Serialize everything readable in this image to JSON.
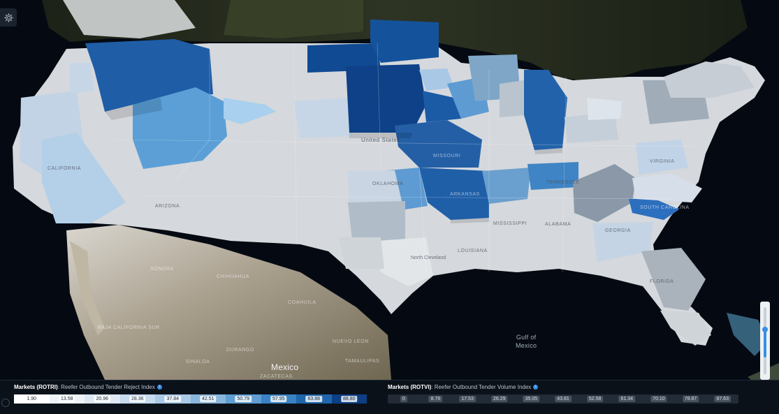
{
  "map": {
    "labels": [
      {
        "id": "label-united-states",
        "text": "United States",
        "style": "dark"
      },
      {
        "id": "label-california",
        "text": "CALIFORNIA",
        "style": "dark"
      },
      {
        "id": "label-arizona",
        "text": "ARIZONA",
        "style": "dark"
      },
      {
        "id": "label-missouri",
        "text": "MISSOURI",
        "style": "dark"
      },
      {
        "id": "label-oklahoma",
        "text": "OKLAHOMA",
        "style": "dark"
      },
      {
        "id": "label-arkansas",
        "text": "ARKANSAS",
        "style": "dark"
      },
      {
        "id": "label-tennessee",
        "text": "TENNESSEE",
        "style": "dark"
      },
      {
        "id": "label-mississippi",
        "text": "MISSISSIPPI",
        "style": "dark"
      },
      {
        "id": "label-alabama",
        "text": "ALABAMA",
        "style": "dark"
      },
      {
        "id": "label-georgia",
        "text": "GEORGIA",
        "style": "dark"
      },
      {
        "id": "label-louisiana",
        "text": "LOUISIANA",
        "style": "dark"
      },
      {
        "id": "label-south-carolina",
        "text": "SOUTH CAROLINA",
        "style": "dark"
      },
      {
        "id": "label-virginia",
        "text": "VIRGINIA",
        "style": "dark"
      },
      {
        "id": "label-florida",
        "text": "FLORIDA",
        "style": "dark"
      },
      {
        "id": "label-north-cleveland",
        "text": "North Cleveland",
        "style": "dark"
      },
      {
        "id": "label-sonora",
        "text": "SONORA",
        "style": "light"
      },
      {
        "id": "label-chihuahua",
        "text": "CHIHUAHUA",
        "style": "light"
      },
      {
        "id": "label-coahuila",
        "text": "COAHUILA",
        "style": "light"
      },
      {
        "id": "label-baja-california-sur",
        "text": "BAJA CALIFORNIA SUR",
        "style": "light"
      },
      {
        "id": "label-nuevo-leon",
        "text": "NUEVO LEON",
        "style": "light"
      },
      {
        "id": "label-sinaloa",
        "text": "SINALOA",
        "style": "light"
      },
      {
        "id": "label-durango",
        "text": "DURANGO",
        "style": "light"
      },
      {
        "id": "label-tamaulipas",
        "text": "TAMAULIPAS",
        "style": "light"
      },
      {
        "id": "label-zacatecas",
        "text": "ZACATECAS",
        "style": "light"
      },
      {
        "id": "label-mexico",
        "text": "Mexico",
        "style": "big"
      },
      {
        "id": "label-gulf-of-mexico",
        "text": "Gulf of\nMexico",
        "style": "sea"
      }
    ]
  },
  "legends": {
    "rotri": {
      "code_label": "Markets (ROTRI)",
      "description": "Reefer Outbound Tender Reject Index",
      "info_icon": "info-icon",
      "swatches": [
        {
          "value": "1.90",
          "color": "#ffffff"
        },
        {
          "value": "13.58",
          "color": "#eef3f9"
        },
        {
          "value": "20.96",
          "color": "#dde8f4"
        },
        {
          "value": "28.36",
          "color": "#c7daee"
        },
        {
          "value": "37.84",
          "color": "#a9c9e6"
        },
        {
          "value": "42.51",
          "color": "#88b5dc"
        },
        {
          "value": "50.79",
          "color": "#5f9dd2"
        },
        {
          "value": "57.95",
          "color": "#3a82c4"
        },
        {
          "value": "63.88",
          "color": "#1f66ad"
        },
        {
          "value": "88.80",
          "color": "#0d3f85"
        }
      ]
    },
    "rotvi": {
      "code_label": "Markets (ROTVI)",
      "description": "Reefer Outbound Tender Volume Index",
      "info_icon": "info-icon",
      "swatches": [
        "0",
        "8.76",
        "17.53",
        "26.29",
        "35.05",
        "43.81",
        "52.58",
        "61.34",
        "70.10",
        "78.87",
        "87.63"
      ]
    }
  },
  "icons": {
    "settings": "gear-icon",
    "zoom": "zoom-slider"
  },
  "colors": {
    "accent": "#3a8fe0",
    "panel": "#0b1119"
  }
}
